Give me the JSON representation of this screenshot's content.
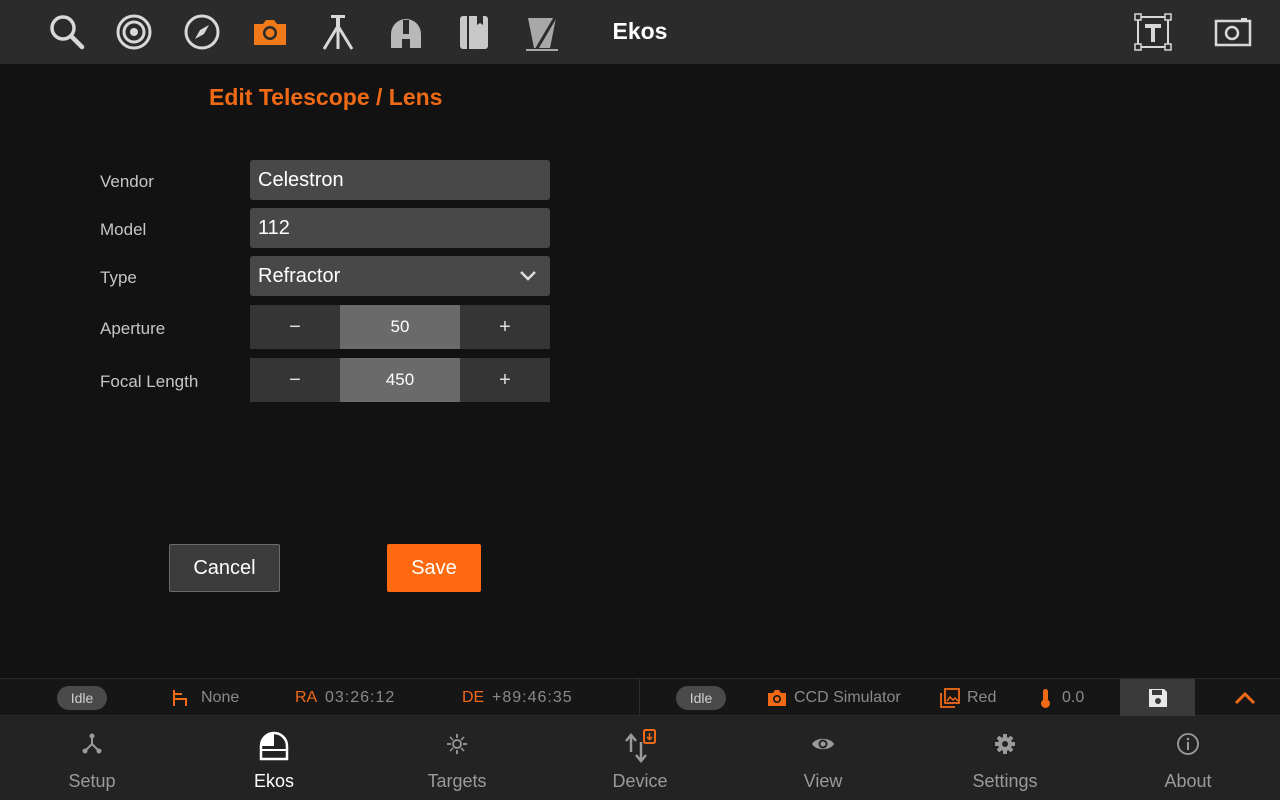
{
  "app": {
    "title": "Ekos"
  },
  "toolbar": {
    "tools": [
      {
        "icon": "search-icon"
      },
      {
        "icon": "target-icon"
      },
      {
        "icon": "compass-icon"
      },
      {
        "icon": "camera-icon",
        "active": true
      },
      {
        "icon": "tripod-icon"
      },
      {
        "icon": "observatory-dome-icon"
      },
      {
        "icon": "notebook-icon"
      },
      {
        "icon": "filter-icon"
      }
    ],
    "right_tools": [
      {
        "icon": "text-frame-icon"
      },
      {
        "icon": "screenshot-icon"
      }
    ]
  },
  "form": {
    "title": "Edit Telescope / Lens",
    "vendor": {
      "label": "Vendor",
      "value": "Celestron"
    },
    "model": {
      "label": "Model",
      "value": "112"
    },
    "type": {
      "label": "Type",
      "value": "Refractor"
    },
    "aperture": {
      "label": "Aperture",
      "value": "50",
      "minus": "−",
      "plus": "+"
    },
    "focal_length": {
      "label": "Focal Length",
      "value": "450",
      "minus": "−",
      "plus": "+"
    },
    "cancel_label": "Cancel",
    "save_label": "Save"
  },
  "status": {
    "mount_state": "Idle",
    "park_text": "None",
    "ra_label": "RA",
    "ra_value": "03:26:12",
    "de_label": "DE",
    "de_value": "+89:46:35",
    "camera_state": "Idle",
    "camera_name": "CCD Simulator",
    "filter_name": "Red",
    "temperature": "0.0"
  },
  "nav": [
    {
      "label": "Setup",
      "icon": "setup-icon"
    },
    {
      "label": "Ekos",
      "icon": "ekos-dome-icon",
      "active": true
    },
    {
      "label": "Targets",
      "icon": "targets-icon"
    },
    {
      "label": "Device",
      "icon": "device-icon"
    },
    {
      "label": "View",
      "icon": "eye-icon"
    },
    {
      "label": "Settings",
      "icon": "gear-icon"
    },
    {
      "label": "About",
      "icon": "info-icon"
    }
  ],
  "colors": {
    "accent": "#f06a16",
    "save": "#ff6a10",
    "background": "#121212",
    "toolbar": "#2b2b2b"
  }
}
